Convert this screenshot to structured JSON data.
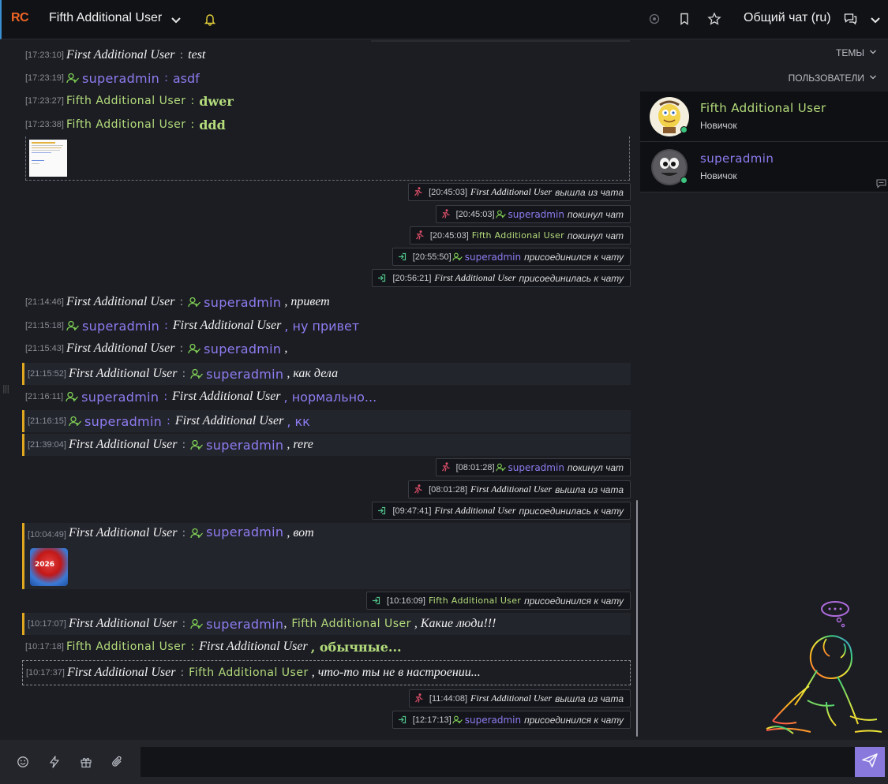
{
  "header": {
    "logo": "RC",
    "room_title": "Fifth Additional User",
    "chat_title": "Общий чат (ru)"
  },
  "sidebar": {
    "topics_label": "ТЕМЫ",
    "users_label": "ПОЛЬЗОВАТЕЛИ",
    "users": [
      {
        "name": "Fifth Additional User",
        "role": "Новичок",
        "color": "#b4dc7c"
      },
      {
        "name": "superadmin",
        "role": "Новичок",
        "color": "#8d7cf0"
      }
    ]
  },
  "messages": [
    {
      "ts": "[17:23:10]",
      "user": "First Additional User",
      "sep": ":",
      "text": "test"
    },
    {
      "ts": "[17:23:19]",
      "user": "superadmin",
      "sep": ":",
      "text": "asdf"
    },
    {
      "ts": "[17:23:27]",
      "user": "Fifth Additional User",
      "sep": ":",
      "text": "dwer"
    },
    {
      "ts": "[17:23:38]",
      "user": "Fifth Additional User",
      "sep": ":",
      "text": "ddd"
    },
    {
      "ts": "[21:14:46]",
      "user": "First Additional User",
      "sep": ":",
      "to": "superadmin",
      "text": ", привет"
    },
    {
      "ts": "[21:15:18]",
      "user": "superadmin",
      "sep": ":",
      "to": "First Additional User",
      "text": ", ну привет"
    },
    {
      "ts": "[21:15:43]",
      "user": "First Additional User",
      "sep": ":",
      "to": "superadmin",
      "text": ","
    },
    {
      "ts": "[21:15:52]",
      "user": "First Additional User",
      "sep": ":",
      "to": "superadmin",
      "text": ", как дела"
    },
    {
      "ts": "[21:16:11]",
      "user": "superadmin",
      "sep": ":",
      "to": "First Additional User",
      "text": ", нормально..."
    },
    {
      "ts": "[21:16:15]",
      "user": "superadmin",
      "sep": ":",
      "to": "First Additional User",
      "text": ", кк"
    },
    {
      "ts": "[21:39:04]",
      "user": "First Additional User",
      "sep": ":",
      "to": "superadmin",
      "text": ", rere"
    },
    {
      "ts": "[10:04:49]",
      "user": "First Additional User",
      "sep": ":",
      "to": "superadmin",
      "text": ", вот"
    },
    {
      "ts": "[10:17:07]",
      "user": "First Additional User",
      "sep": ":",
      "to": "superadmin",
      "to2": "Fifth Additional User",
      "text": ", Какие люди!!!",
      "comma": ","
    },
    {
      "ts": "[10:17:18]",
      "user": "Fifth Additional User",
      "sep": ":",
      "to": "First Additional User",
      "text": ", обычные..."
    },
    {
      "ts": "[10:17:37]",
      "user": "First Additional User",
      "sep": ":",
      "to": "Fifth Additional User",
      "text": ", что-то ты не в настроении..."
    }
  ],
  "thumb2_text": "2026",
  "system": [
    {
      "ts": "[20:45:03]",
      "user": "First Additional User",
      "action": "вышла из чата"
    },
    {
      "ts": "[20:45:03]",
      "user": "superadmin",
      "action": "покинул чат"
    },
    {
      "ts": "[20:45:03]",
      "user": "Fifth Additional User",
      "action": "покинул чат"
    },
    {
      "ts": "[20:55:50]",
      "user": "superadmin",
      "action": "присоединился к чату"
    },
    {
      "ts": "[20:56:21]",
      "user": "First Additional User",
      "action": "присоединилась к чату"
    },
    {
      "ts": "[08:01:28]",
      "user": "superadmin",
      "action": "покинул чат"
    },
    {
      "ts": "[08:01:28]",
      "user": "First Additional User",
      "action": "вышла из чата"
    },
    {
      "ts": "[09:47:41]",
      "user": "First Additional User",
      "action": "присоединилась к чату"
    },
    {
      "ts": "[10:16:09]",
      "user": "Fifth Additional User",
      "action": "присоединился к чату"
    },
    {
      "ts": "[11:44:08]",
      "user": "First Additional User",
      "action": "вышла из чата"
    },
    {
      "ts": "[12:17:13]",
      "user": "superadmin",
      "action": "присоединился к чату"
    }
  ],
  "colors": {
    "accent": "#8a79dc",
    "superadmin": "#8d7cf0",
    "fifth_user": "#b4dc7c",
    "highlight_border": "#e0a81f",
    "logo": "#ee6524",
    "online": "#3cc57e"
  },
  "icons": {
    "header": [
      "chevron-down-icon",
      "bell-icon",
      "target-icon",
      "bookmark-icon",
      "star-icon",
      "chat-bubbles-icon",
      "chevron-down-icon"
    ],
    "composer": [
      "smile-icon",
      "lightning-icon",
      "gift-icon",
      "paperclip-icon",
      "send-icon"
    ],
    "system": [
      "running-person-icon",
      "enter-icon"
    ]
  }
}
